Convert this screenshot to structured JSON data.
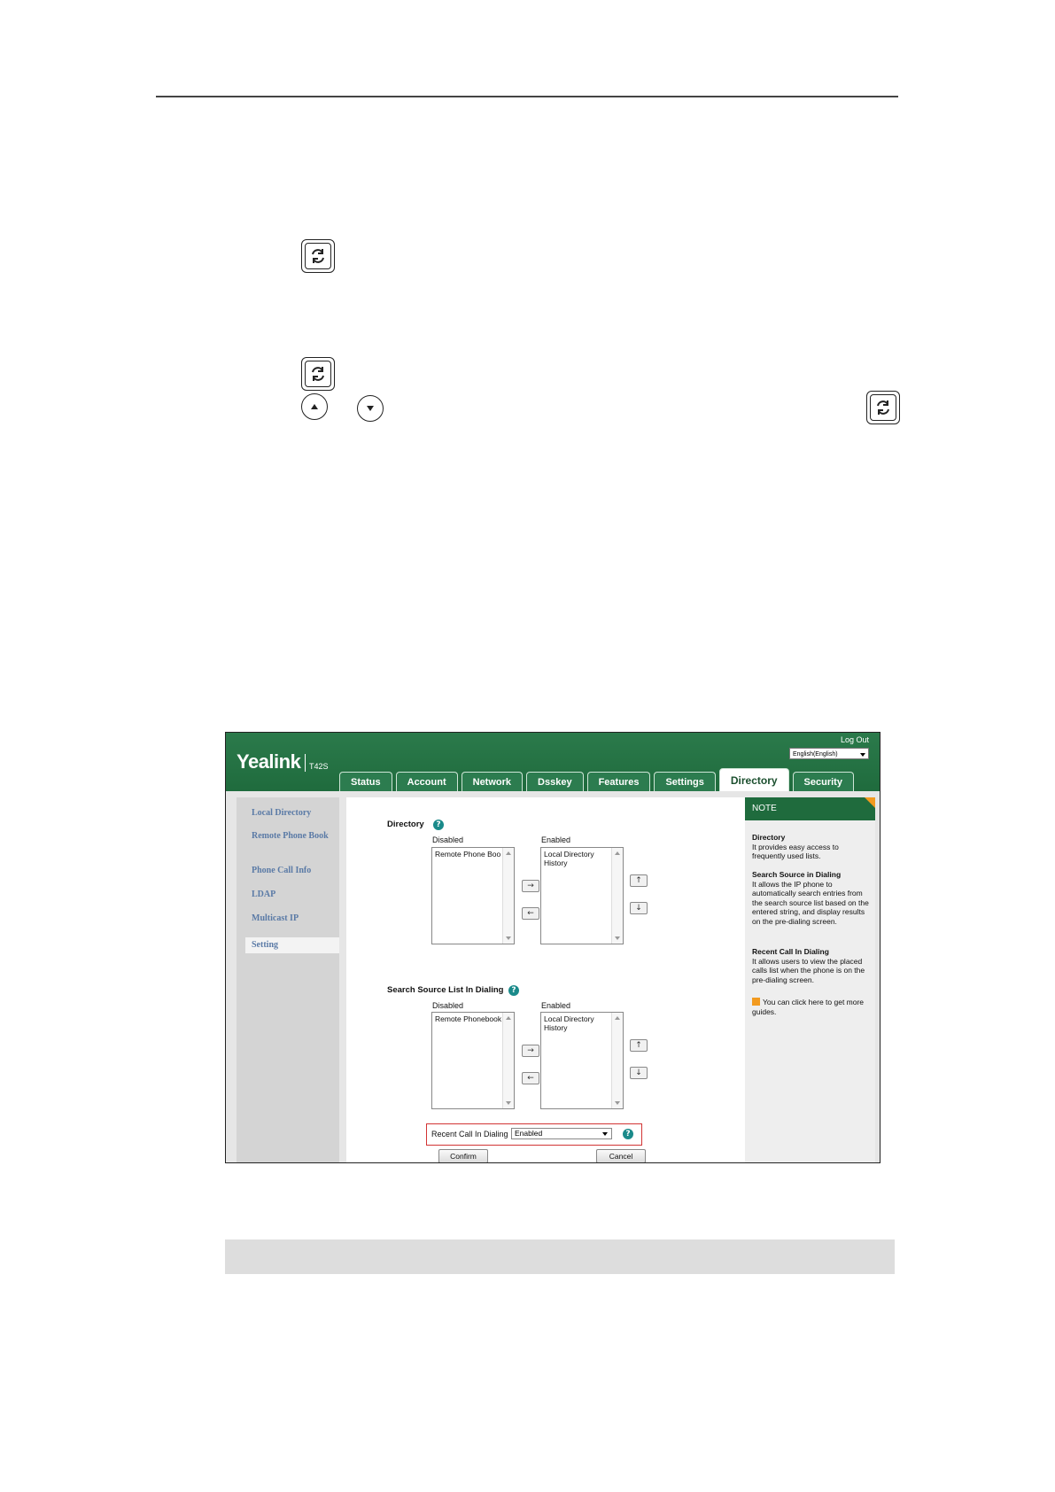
{
  "web_ui": {
    "logo": "Yealink",
    "model": "T42S",
    "logout": "Log Out",
    "language": "English(English)",
    "tabs": [
      "Status",
      "Account",
      "Network",
      "Dsskey",
      "Features",
      "Settings",
      "Directory",
      "Security"
    ],
    "active_tab": "Directory",
    "sidebar": [
      "Local Directory",
      "Remote Phone Book",
      "Phone Call Info",
      "LDAP",
      "Multicast IP",
      "Setting"
    ],
    "sidebar_selected": "Setting",
    "directory": {
      "title": "Directory",
      "disabled_label": "Disabled",
      "enabled_label": "Enabled",
      "disabled_items": [
        "Remote Phone Boo"
      ],
      "enabled_items": [
        "Local Directory",
        "History"
      ]
    },
    "search_source": {
      "title": "Search Source List In Dialing",
      "disabled_label": "Disabled",
      "enabled_label": "Enabled",
      "disabled_items": [
        "Remote Phonebook"
      ],
      "enabled_items": [
        "Local Directory",
        "History"
      ]
    },
    "recent_call": {
      "label": "Recent Call In Dialing",
      "value": "Enabled"
    },
    "confirm": "Confirm",
    "cancel": "Cancel",
    "note": {
      "title": "NOTE",
      "items": [
        {
          "heading": "Directory",
          "text": "It provides easy access to frequently used lists."
        },
        {
          "heading": "Search Source in Dialing",
          "text": "It allows the IP phone to automatically search entries from the search source list based on the entered string, and display results on the pre-dialing screen."
        },
        {
          "heading": "Recent Call In Dialing",
          "text": "It allows users to view the placed calls list when the phone is on the pre-dialing screen."
        }
      ],
      "guide": "You can click here to get more guides."
    }
  },
  "colors": {
    "brand_green": "#1f6b3d",
    "note_fold": "#f29a1f",
    "highlight_red": "#d23434",
    "help_teal": "#1a8a8a"
  }
}
